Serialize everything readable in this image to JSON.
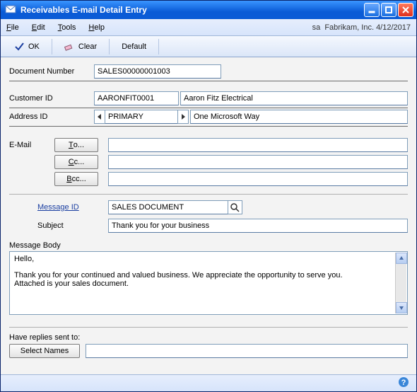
{
  "window": {
    "title": "Receivables E-mail Detail Entry"
  },
  "menubar": {
    "file": "File",
    "edit": "Edit",
    "tools": "Tools",
    "help": "Help",
    "status_user": "sa",
    "status_company": "Fabrikam, Inc.",
    "status_date": "4/12/2017"
  },
  "toolbar": {
    "ok": "OK",
    "clear": "Clear",
    "default": "Default"
  },
  "form": {
    "doc_number_label": "Document Number",
    "doc_number": "SALES00000001003",
    "customer_id_label": "Customer ID",
    "customer_id": "AARONFIT0001",
    "customer_name": "Aaron Fitz Electrical",
    "address_id_label": "Address ID",
    "address_id": "PRIMARY",
    "address_line": "One Microsoft Way",
    "email_label": "E-Mail",
    "to_btn": "To...",
    "cc_btn": "Cc...",
    "bcc_btn": "Bcc...",
    "to_value": "",
    "cc_value": "",
    "bcc_value": "",
    "message_id_label": "Message ID",
    "message_id": "SALES DOCUMENT",
    "subject_label": "Subject",
    "subject": "Thank you for your business",
    "message_body_label": "Message Body",
    "message_body_line1": "Hello,",
    "message_body_line2": "Thank you for your continued and valued business.  We appreciate the opportunity to serve you.",
    "message_body_line3": "Attached is your sales document.",
    "replies_label": "Have replies sent to:",
    "select_names_btn": "Select Names",
    "replies_value": ""
  }
}
